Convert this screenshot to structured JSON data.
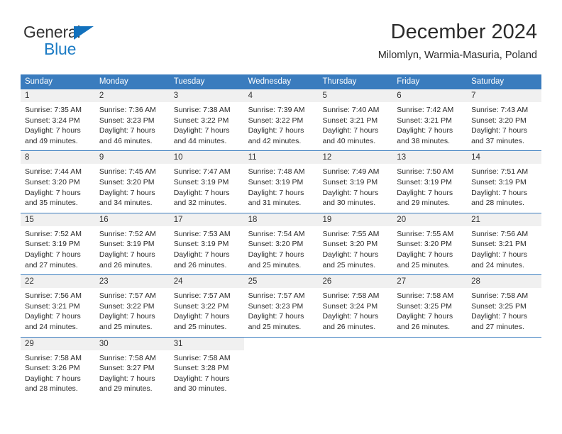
{
  "brand": {
    "name_top": "General",
    "name_bottom": "Blue",
    "triangle_color": "#1271bd",
    "blue_text_color": "#1b7bc4"
  },
  "header": {
    "title": "December 2024",
    "subtitle": "Milomlyn, Warmia-Masuria, Poland"
  },
  "colors": {
    "header_blue": "#3a7cbe",
    "daynum_band": "#f0f0f0",
    "text": "#2b2b2b"
  },
  "weekdays": [
    "Sunday",
    "Monday",
    "Tuesday",
    "Wednesday",
    "Thursday",
    "Friday",
    "Saturday"
  ],
  "weeks": [
    [
      {
        "day": "1",
        "sunrise": "Sunrise: 7:35 AM",
        "sunset": "Sunset: 3:24 PM",
        "daylight1": "Daylight: 7 hours",
        "daylight2": "and 49 minutes."
      },
      {
        "day": "2",
        "sunrise": "Sunrise: 7:36 AM",
        "sunset": "Sunset: 3:23 PM",
        "daylight1": "Daylight: 7 hours",
        "daylight2": "and 46 minutes."
      },
      {
        "day": "3",
        "sunrise": "Sunrise: 7:38 AM",
        "sunset": "Sunset: 3:22 PM",
        "daylight1": "Daylight: 7 hours",
        "daylight2": "and 44 minutes."
      },
      {
        "day": "4",
        "sunrise": "Sunrise: 7:39 AM",
        "sunset": "Sunset: 3:22 PM",
        "daylight1": "Daylight: 7 hours",
        "daylight2": "and 42 minutes."
      },
      {
        "day": "5",
        "sunrise": "Sunrise: 7:40 AM",
        "sunset": "Sunset: 3:21 PM",
        "daylight1": "Daylight: 7 hours",
        "daylight2": "and 40 minutes."
      },
      {
        "day": "6",
        "sunrise": "Sunrise: 7:42 AM",
        "sunset": "Sunset: 3:21 PM",
        "daylight1": "Daylight: 7 hours",
        "daylight2": "and 38 minutes."
      },
      {
        "day": "7",
        "sunrise": "Sunrise: 7:43 AM",
        "sunset": "Sunset: 3:20 PM",
        "daylight1": "Daylight: 7 hours",
        "daylight2": "and 37 minutes."
      }
    ],
    [
      {
        "day": "8",
        "sunrise": "Sunrise: 7:44 AM",
        "sunset": "Sunset: 3:20 PM",
        "daylight1": "Daylight: 7 hours",
        "daylight2": "and 35 minutes."
      },
      {
        "day": "9",
        "sunrise": "Sunrise: 7:45 AM",
        "sunset": "Sunset: 3:20 PM",
        "daylight1": "Daylight: 7 hours",
        "daylight2": "and 34 minutes."
      },
      {
        "day": "10",
        "sunrise": "Sunrise: 7:47 AM",
        "sunset": "Sunset: 3:19 PM",
        "daylight1": "Daylight: 7 hours",
        "daylight2": "and 32 minutes."
      },
      {
        "day": "11",
        "sunrise": "Sunrise: 7:48 AM",
        "sunset": "Sunset: 3:19 PM",
        "daylight1": "Daylight: 7 hours",
        "daylight2": "and 31 minutes."
      },
      {
        "day": "12",
        "sunrise": "Sunrise: 7:49 AM",
        "sunset": "Sunset: 3:19 PM",
        "daylight1": "Daylight: 7 hours",
        "daylight2": "and 30 minutes."
      },
      {
        "day": "13",
        "sunrise": "Sunrise: 7:50 AM",
        "sunset": "Sunset: 3:19 PM",
        "daylight1": "Daylight: 7 hours",
        "daylight2": "and 29 minutes."
      },
      {
        "day": "14",
        "sunrise": "Sunrise: 7:51 AM",
        "sunset": "Sunset: 3:19 PM",
        "daylight1": "Daylight: 7 hours",
        "daylight2": "and 28 minutes."
      }
    ],
    [
      {
        "day": "15",
        "sunrise": "Sunrise: 7:52 AM",
        "sunset": "Sunset: 3:19 PM",
        "daylight1": "Daylight: 7 hours",
        "daylight2": "and 27 minutes."
      },
      {
        "day": "16",
        "sunrise": "Sunrise: 7:52 AM",
        "sunset": "Sunset: 3:19 PM",
        "daylight1": "Daylight: 7 hours",
        "daylight2": "and 26 minutes."
      },
      {
        "day": "17",
        "sunrise": "Sunrise: 7:53 AM",
        "sunset": "Sunset: 3:19 PM",
        "daylight1": "Daylight: 7 hours",
        "daylight2": "and 26 minutes."
      },
      {
        "day": "18",
        "sunrise": "Sunrise: 7:54 AM",
        "sunset": "Sunset: 3:20 PM",
        "daylight1": "Daylight: 7 hours",
        "daylight2": "and 25 minutes."
      },
      {
        "day": "19",
        "sunrise": "Sunrise: 7:55 AM",
        "sunset": "Sunset: 3:20 PM",
        "daylight1": "Daylight: 7 hours",
        "daylight2": "and 25 minutes."
      },
      {
        "day": "20",
        "sunrise": "Sunrise: 7:55 AM",
        "sunset": "Sunset: 3:20 PM",
        "daylight1": "Daylight: 7 hours",
        "daylight2": "and 25 minutes."
      },
      {
        "day": "21",
        "sunrise": "Sunrise: 7:56 AM",
        "sunset": "Sunset: 3:21 PM",
        "daylight1": "Daylight: 7 hours",
        "daylight2": "and 24 minutes."
      }
    ],
    [
      {
        "day": "22",
        "sunrise": "Sunrise: 7:56 AM",
        "sunset": "Sunset: 3:21 PM",
        "daylight1": "Daylight: 7 hours",
        "daylight2": "and 24 minutes."
      },
      {
        "day": "23",
        "sunrise": "Sunrise: 7:57 AM",
        "sunset": "Sunset: 3:22 PM",
        "daylight1": "Daylight: 7 hours",
        "daylight2": "and 25 minutes."
      },
      {
        "day": "24",
        "sunrise": "Sunrise: 7:57 AM",
        "sunset": "Sunset: 3:22 PM",
        "daylight1": "Daylight: 7 hours",
        "daylight2": "and 25 minutes."
      },
      {
        "day": "25",
        "sunrise": "Sunrise: 7:57 AM",
        "sunset": "Sunset: 3:23 PM",
        "daylight1": "Daylight: 7 hours",
        "daylight2": "and 25 minutes."
      },
      {
        "day": "26",
        "sunrise": "Sunrise: 7:58 AM",
        "sunset": "Sunset: 3:24 PM",
        "daylight1": "Daylight: 7 hours",
        "daylight2": "and 26 minutes."
      },
      {
        "day": "27",
        "sunrise": "Sunrise: 7:58 AM",
        "sunset": "Sunset: 3:25 PM",
        "daylight1": "Daylight: 7 hours",
        "daylight2": "and 26 minutes."
      },
      {
        "day": "28",
        "sunrise": "Sunrise: 7:58 AM",
        "sunset": "Sunset: 3:25 PM",
        "daylight1": "Daylight: 7 hours",
        "daylight2": "and 27 minutes."
      }
    ],
    [
      {
        "day": "29",
        "sunrise": "Sunrise: 7:58 AM",
        "sunset": "Sunset: 3:26 PM",
        "daylight1": "Daylight: 7 hours",
        "daylight2": "and 28 minutes."
      },
      {
        "day": "30",
        "sunrise": "Sunrise: 7:58 AM",
        "sunset": "Sunset: 3:27 PM",
        "daylight1": "Daylight: 7 hours",
        "daylight2": "and 29 minutes."
      },
      {
        "day": "31",
        "sunrise": "Sunrise: 7:58 AM",
        "sunset": "Sunset: 3:28 PM",
        "daylight1": "Daylight: 7 hours",
        "daylight2": "and 30 minutes."
      },
      {
        "day": "",
        "sunrise": "",
        "sunset": "",
        "daylight1": "",
        "daylight2": ""
      },
      {
        "day": "",
        "sunrise": "",
        "sunset": "",
        "daylight1": "",
        "daylight2": ""
      },
      {
        "day": "",
        "sunrise": "",
        "sunset": "",
        "daylight1": "",
        "daylight2": ""
      },
      {
        "day": "",
        "sunrise": "",
        "sunset": "",
        "daylight1": "",
        "daylight2": ""
      }
    ]
  ]
}
